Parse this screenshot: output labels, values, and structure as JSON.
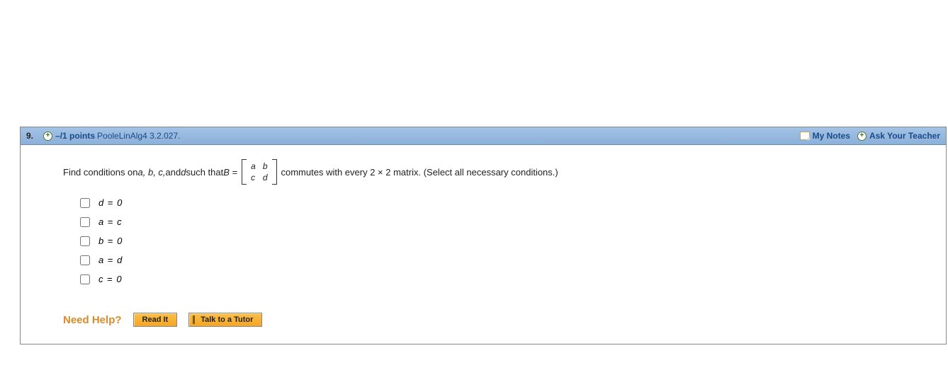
{
  "header": {
    "number": "9.",
    "points_prefix": "–/1 points",
    "source": "PooleLinAlg4 3.2.027.",
    "my_notes": "My Notes",
    "ask_teacher": "Ask Your Teacher"
  },
  "prompt": {
    "before": "Find conditions on ",
    "vars": "a, b, c,",
    "and_text": " and ",
    "var_d": "d",
    "such_that": " such that  ",
    "B_eq": "B = ",
    "matrix": {
      "r1c1": "a",
      "r1c2": "b",
      "r2c1": "c",
      "r2c2": "d"
    },
    "after_matrix": "  commutes with every  2 × 2  matrix. (Select all necessary conditions.)"
  },
  "options": [
    {
      "var_left": "d",
      "op": " = ",
      "var_right": "0"
    },
    {
      "var_left": "a",
      "op": " = ",
      "var_right": "c"
    },
    {
      "var_left": "b",
      "op": " = ",
      "var_right": "0"
    },
    {
      "var_left": "a",
      "op": " = ",
      "var_right": "d"
    },
    {
      "var_left": "c",
      "op": " = ",
      "var_right": "0"
    }
  ],
  "help": {
    "label": "Need Help?",
    "read_it": "Read It",
    "tutor": "Talk to a Tutor"
  }
}
